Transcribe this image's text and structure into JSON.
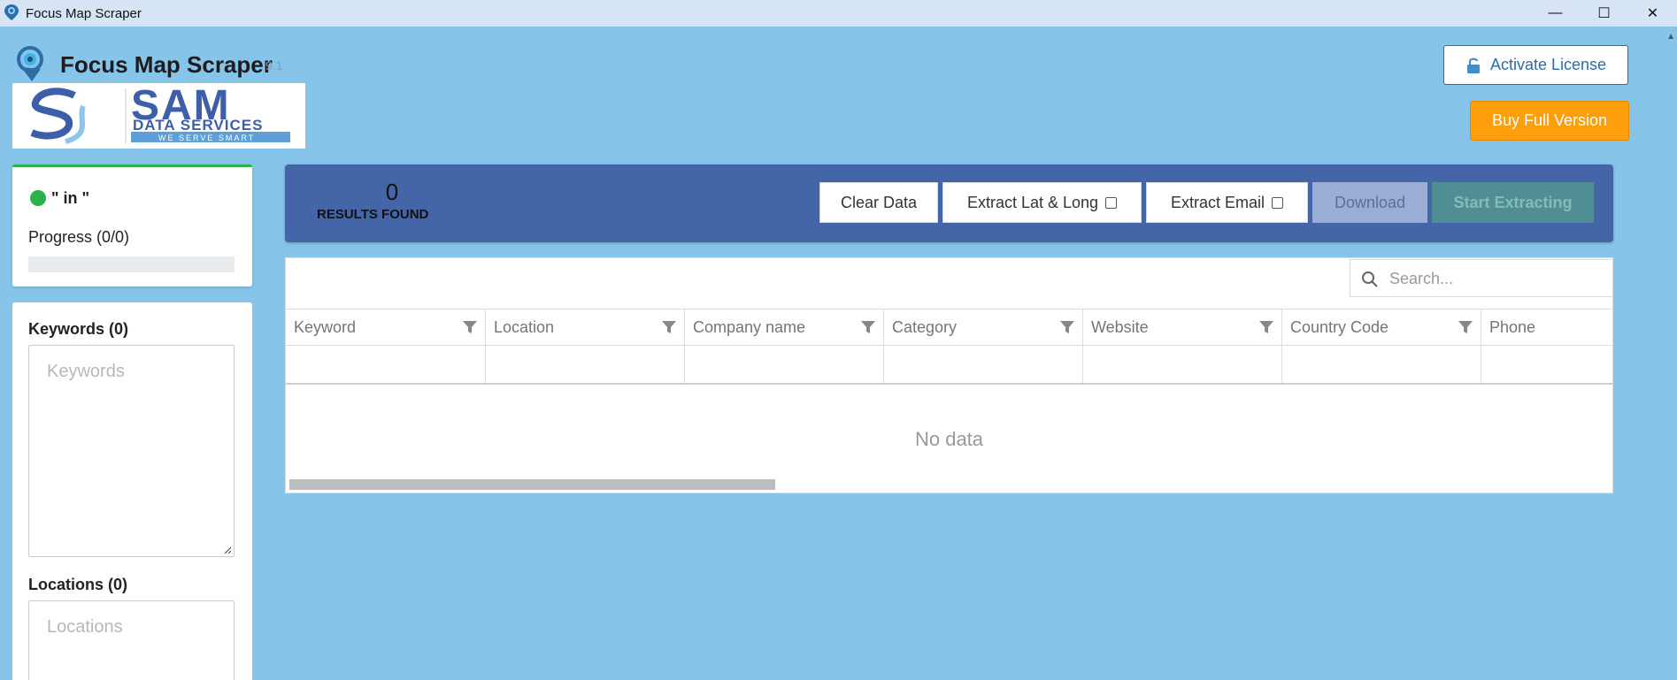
{
  "window": {
    "title": "Focus Map Scraper",
    "controls": [
      "—",
      "☐",
      "✕"
    ]
  },
  "header": {
    "app_name": "Focus Map Scraper",
    "version": "9.1",
    "activate_label": "Activate License",
    "buy_label": "Buy Full Version",
    "accent_color": "#2c6da8",
    "buy_color": "#ff9e0d"
  },
  "brand": {
    "name": "SAM",
    "subtitle": "DATA SERVICES",
    "tagline": "WE SERVE SMART"
  },
  "status": {
    "text": "\" in \"",
    "progress_label": "Progress (0/0)",
    "progress_fraction": 0,
    "status_color": "#2bb24c"
  },
  "inputs": {
    "keywords_label": "Keywords (0)",
    "keywords_placeholder": "Keywords",
    "locations_label": "Locations (0)",
    "locations_placeholder": "Locations"
  },
  "results": {
    "count": "0",
    "label": "RESULTS FOUND",
    "clear_label": "Clear Data",
    "latlong_label": "Extract Lat & Long",
    "email_label": "Extract Email",
    "download_label": "Download",
    "start_label": "Start Extracting"
  },
  "grid": {
    "search_placeholder": "Search...",
    "columns": [
      "Keyword",
      "Location",
      "Company name",
      "Category",
      "Website",
      "Country Code",
      "Phone"
    ],
    "empty_text": "No data"
  }
}
